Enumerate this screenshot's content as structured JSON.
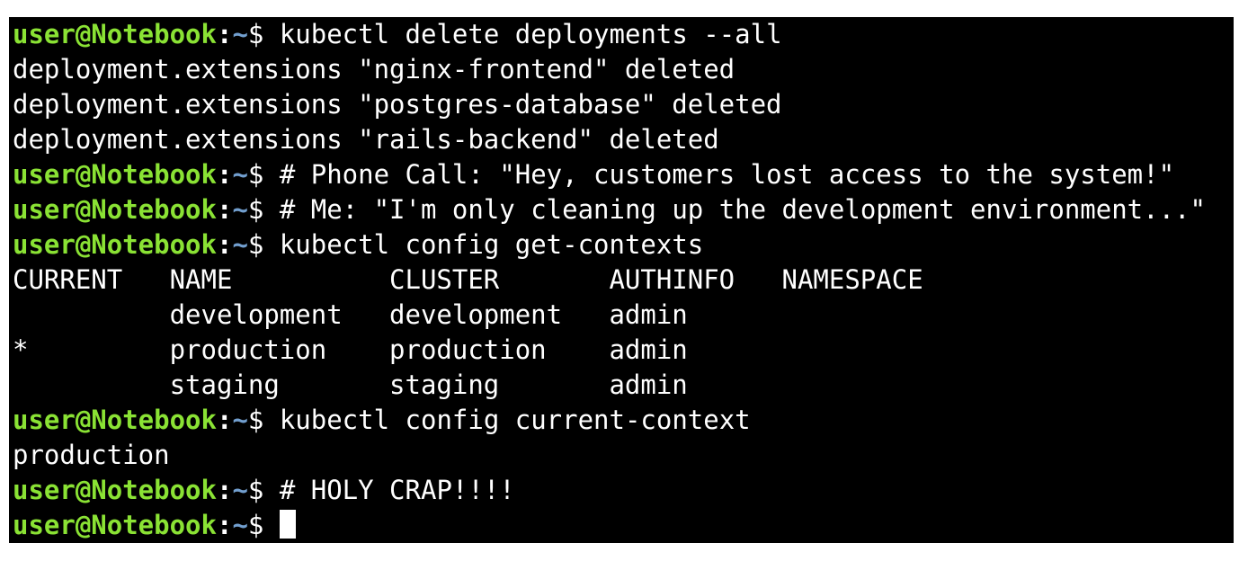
{
  "terminal": {
    "prompt": {
      "user_host": "user@Notebook",
      "colon": ":",
      "path": "~",
      "dollar": "$ "
    },
    "lines": [
      {
        "type": "prompt",
        "command": "kubectl delete deployments --all"
      },
      {
        "type": "output",
        "text": "deployment.extensions \"nginx-frontend\" deleted"
      },
      {
        "type": "output",
        "text": "deployment.extensions \"postgres-database\" deleted"
      },
      {
        "type": "output",
        "text": "deployment.extensions \"rails-backend\" deleted"
      },
      {
        "type": "prompt",
        "command": "# Phone Call: \"Hey, customers lost access to the system!\""
      },
      {
        "type": "prompt",
        "command": "# Me: \"I'm only cleaning up the development environment...\""
      },
      {
        "type": "prompt",
        "command": "kubectl config get-contexts"
      },
      {
        "type": "output",
        "text": "CURRENT   NAME          CLUSTER       AUTHINFO   NAMESPACE"
      },
      {
        "type": "output",
        "text": "          development   development   admin"
      },
      {
        "type": "output",
        "text": "*         production    production    admin"
      },
      {
        "type": "output",
        "text": "          staging       staging       admin"
      },
      {
        "type": "prompt",
        "command": "kubectl config current-context"
      },
      {
        "type": "output",
        "text": "production"
      },
      {
        "type": "prompt",
        "command": "# HOLY CRAP!!!!"
      },
      {
        "type": "prompt",
        "command": "",
        "cursor": true
      }
    ]
  },
  "colors": {
    "background": "#000000",
    "foreground": "#ffffff",
    "prompt_user": "#8ae234",
    "prompt_path": "#729fcf"
  }
}
